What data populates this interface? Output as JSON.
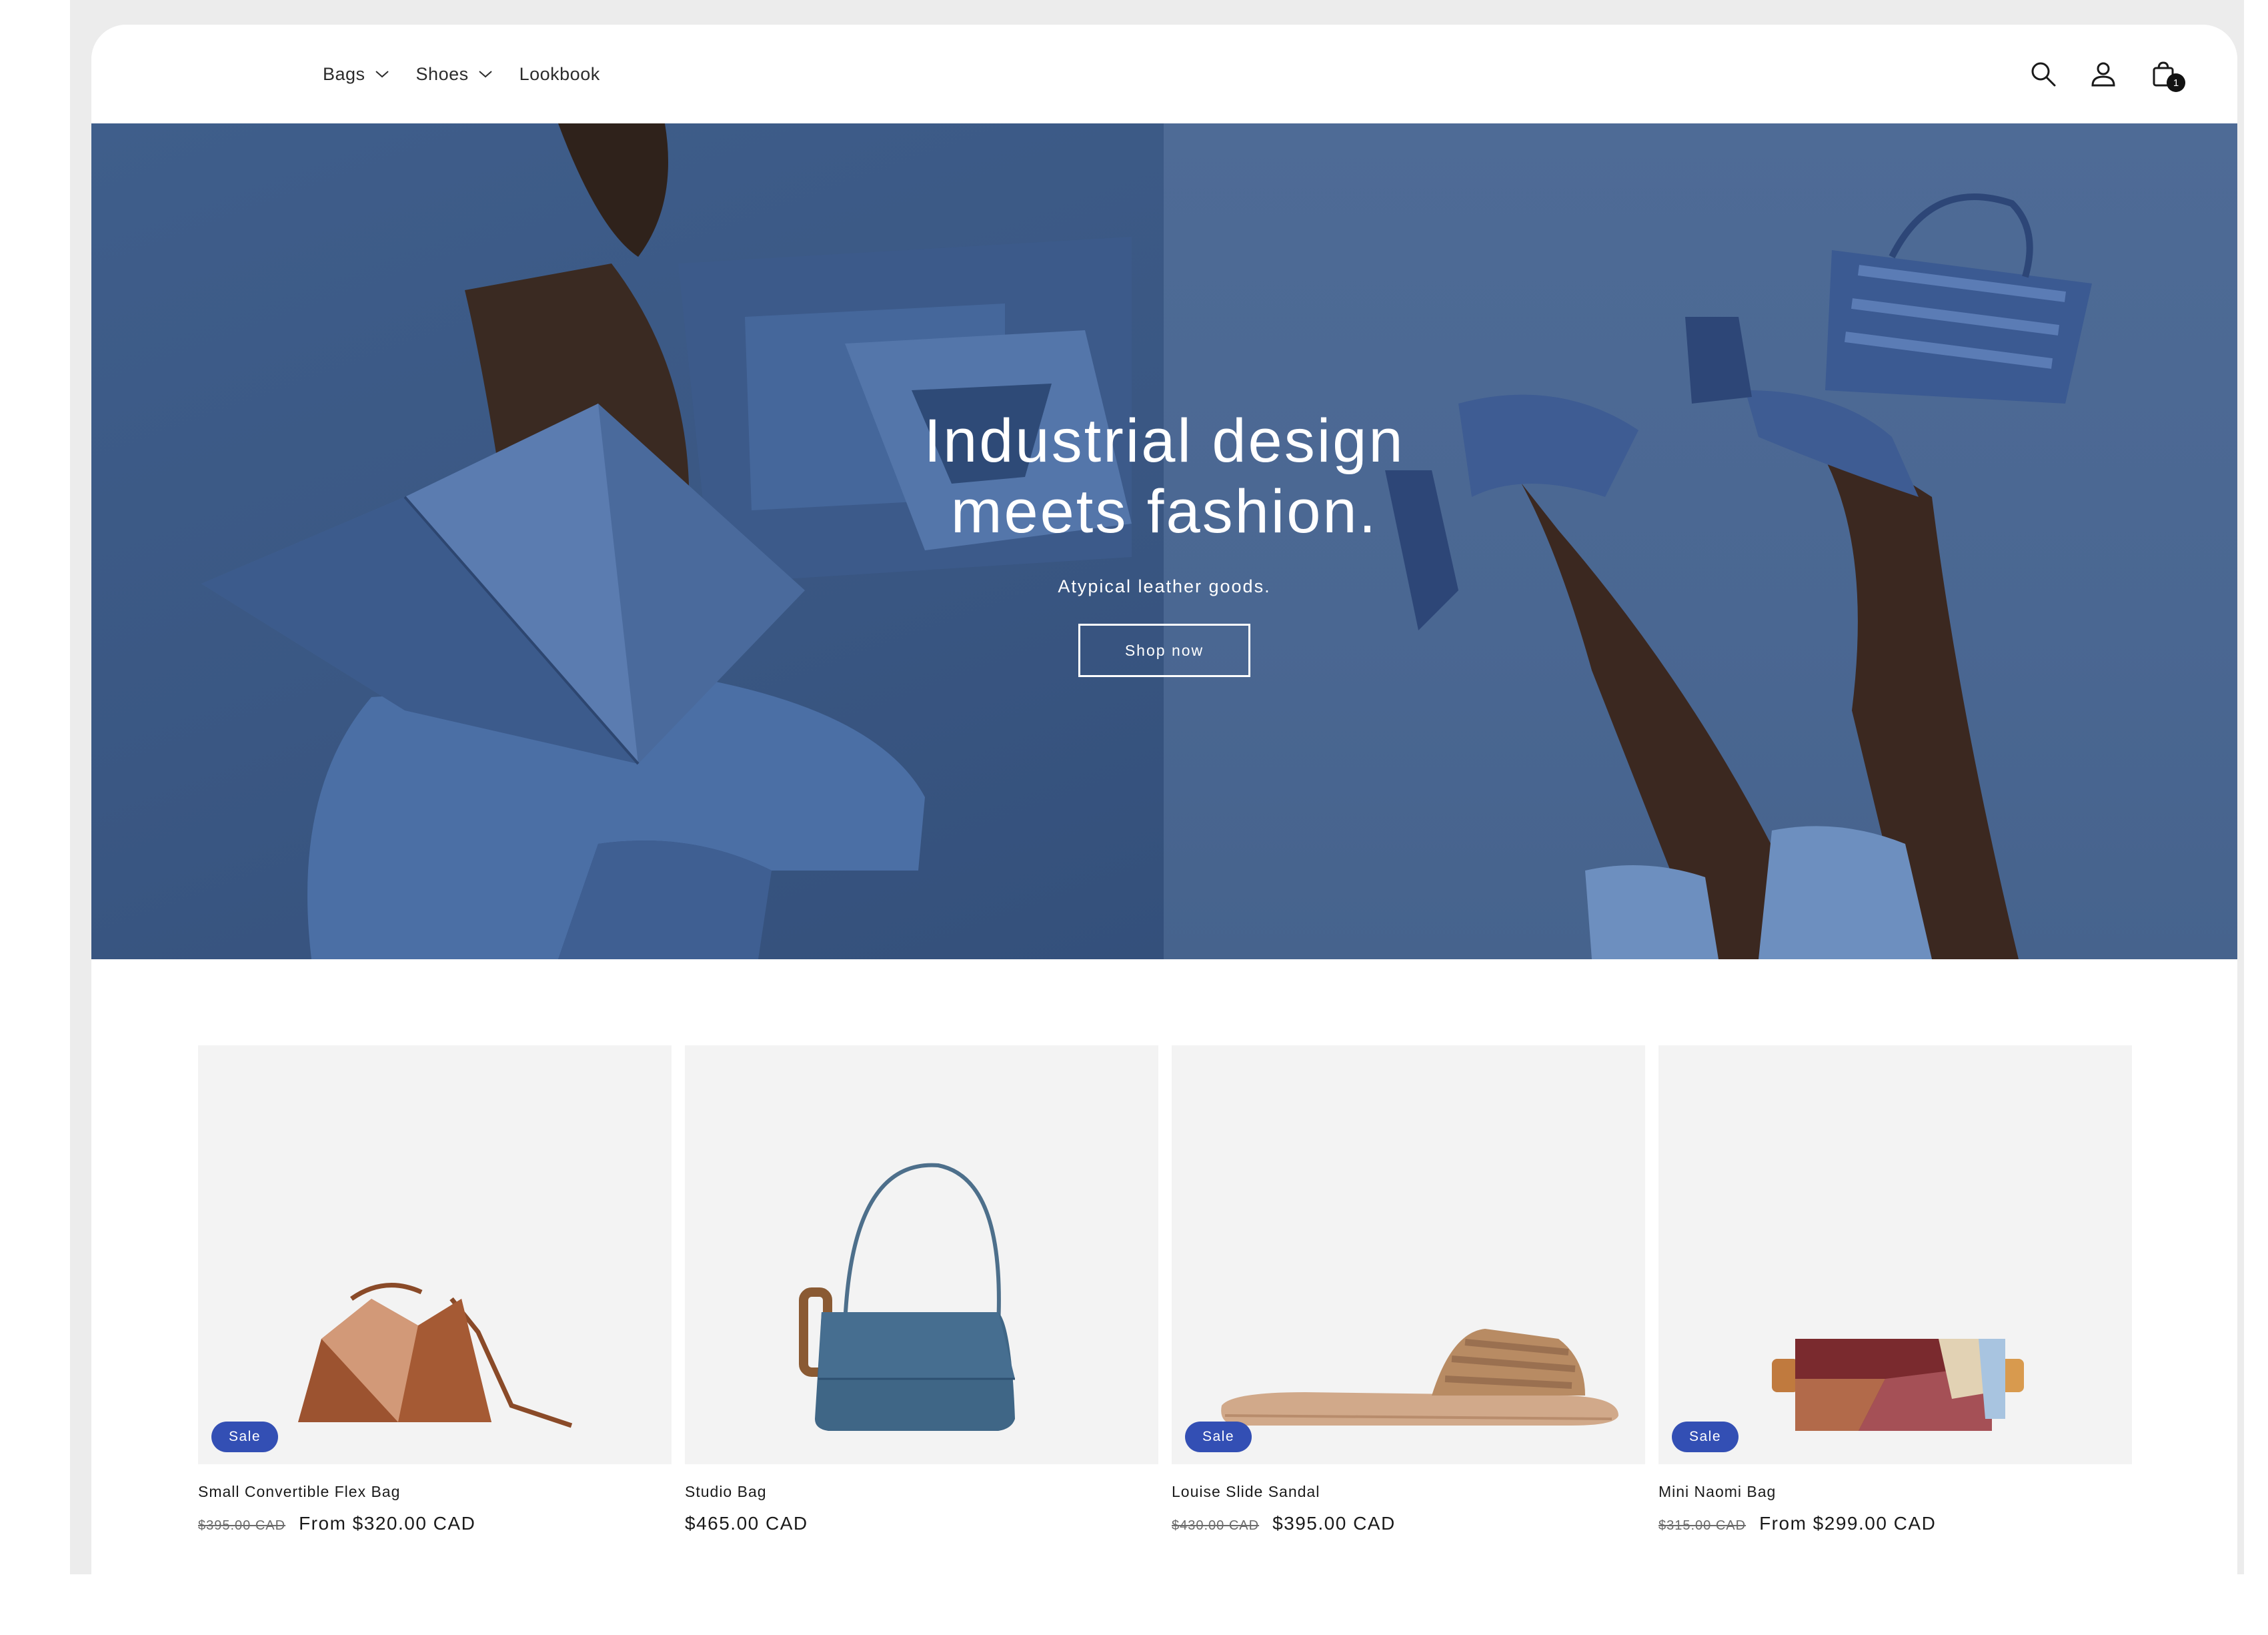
{
  "nav": {
    "items": [
      {
        "label": "Bags",
        "has_dropdown": true
      },
      {
        "label": "Shoes",
        "has_dropdown": true
      },
      {
        "label": "Lookbook",
        "has_dropdown": false
      }
    ]
  },
  "header_icons": {
    "search": "search-icon",
    "account": "user-icon",
    "cart": "cart-icon",
    "cart_count": "1"
  },
  "hero": {
    "title": "Industrial design meets fashion.",
    "subtitle": "Atypical leather goods.",
    "button_label": "Shop now"
  },
  "products": [
    {
      "title": "Small Convertible Flex Bag",
      "old_price": "$395.00 CAD",
      "price": "From $320.00 CAD",
      "badge": "Sale"
    },
    {
      "title": "Studio Bag",
      "old_price": "",
      "price": "$465.00 CAD",
      "badge": ""
    },
    {
      "title": "Louise Slide Sandal",
      "old_price": "$430.00 CAD",
      "price": "$395.00 CAD",
      "badge": "Sale"
    },
    {
      "title": "Mini Naomi Bag",
      "old_price": "$315.00 CAD",
      "price": "From $299.00 CAD",
      "badge": "Sale"
    }
  ],
  "colors": {
    "hero_blue": "#41618d",
    "sale_badge": "#334fb4",
    "card_bg": "#f3f3f3",
    "text": "#1a1a1a"
  }
}
